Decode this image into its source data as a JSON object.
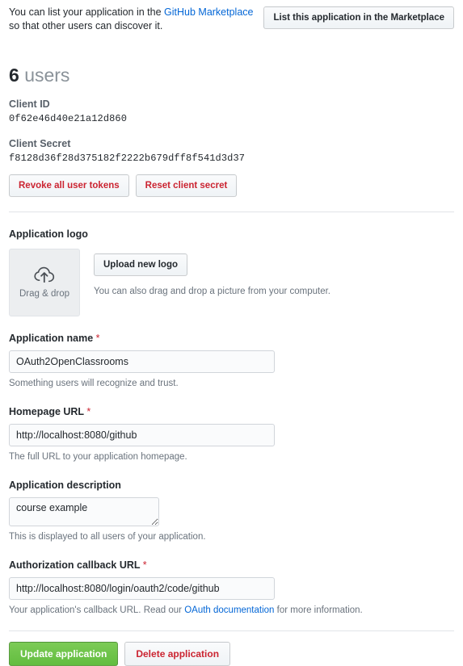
{
  "marketplace": {
    "text_before": "You can list your application in the ",
    "link_label": "GitHub Marketplace",
    "text_after": " so that other users can discover it.",
    "button_label": "List this application in the Marketplace"
  },
  "users": {
    "count": "6",
    "label": "users"
  },
  "credentials": {
    "client_id_label": "Client ID",
    "client_id_value": "0f62e46d40e21a12d860",
    "client_secret_label": "Client Secret",
    "client_secret_value": "f8128d36f28d375182f2222b679dff8f541d3d37",
    "revoke_button": "Revoke all user tokens",
    "reset_button": "Reset client secret"
  },
  "logo": {
    "section_label": "Application logo",
    "dropzone_icon": "cloud-upload-icon",
    "dropzone_label": "Drag & drop",
    "upload_button": "Upload new logo",
    "hint": "You can also drag and drop a picture from your computer."
  },
  "fields": {
    "app_name": {
      "label": "Application name",
      "required": "*",
      "value": "OAuth2OpenClassrooms",
      "placeholder": "Application name",
      "hint": "Something users will recognize and trust."
    },
    "homepage_url": {
      "label": "Homepage URL",
      "required": "*",
      "value": "http://localhost:8080/github",
      "placeholder": "Homepage URL",
      "hint": "The full URL to your application homepage."
    },
    "description": {
      "label": "Application description",
      "required": "",
      "value": "course example",
      "placeholder": "Application description",
      "hint": "This is displayed to all users of your application."
    },
    "callback_url": {
      "label": "Authorization callback URL",
      "required": "*",
      "value": "http://localhost:8080/login/oauth2/code/github",
      "placeholder": "Authorization callback URL",
      "hint_before": "Your application's callback URL. Read our ",
      "hint_link": "OAuth documentation",
      "hint_after": " for more information."
    }
  },
  "footer": {
    "update_button": "Update application",
    "delete_button": "Delete application"
  },
  "colors": {
    "link_blue": "#0366d6",
    "danger_red": "#cb2431",
    "primary_green": "#6cc644",
    "border_gray": "#e1e4e8",
    "muted_text": "#6a737d"
  }
}
